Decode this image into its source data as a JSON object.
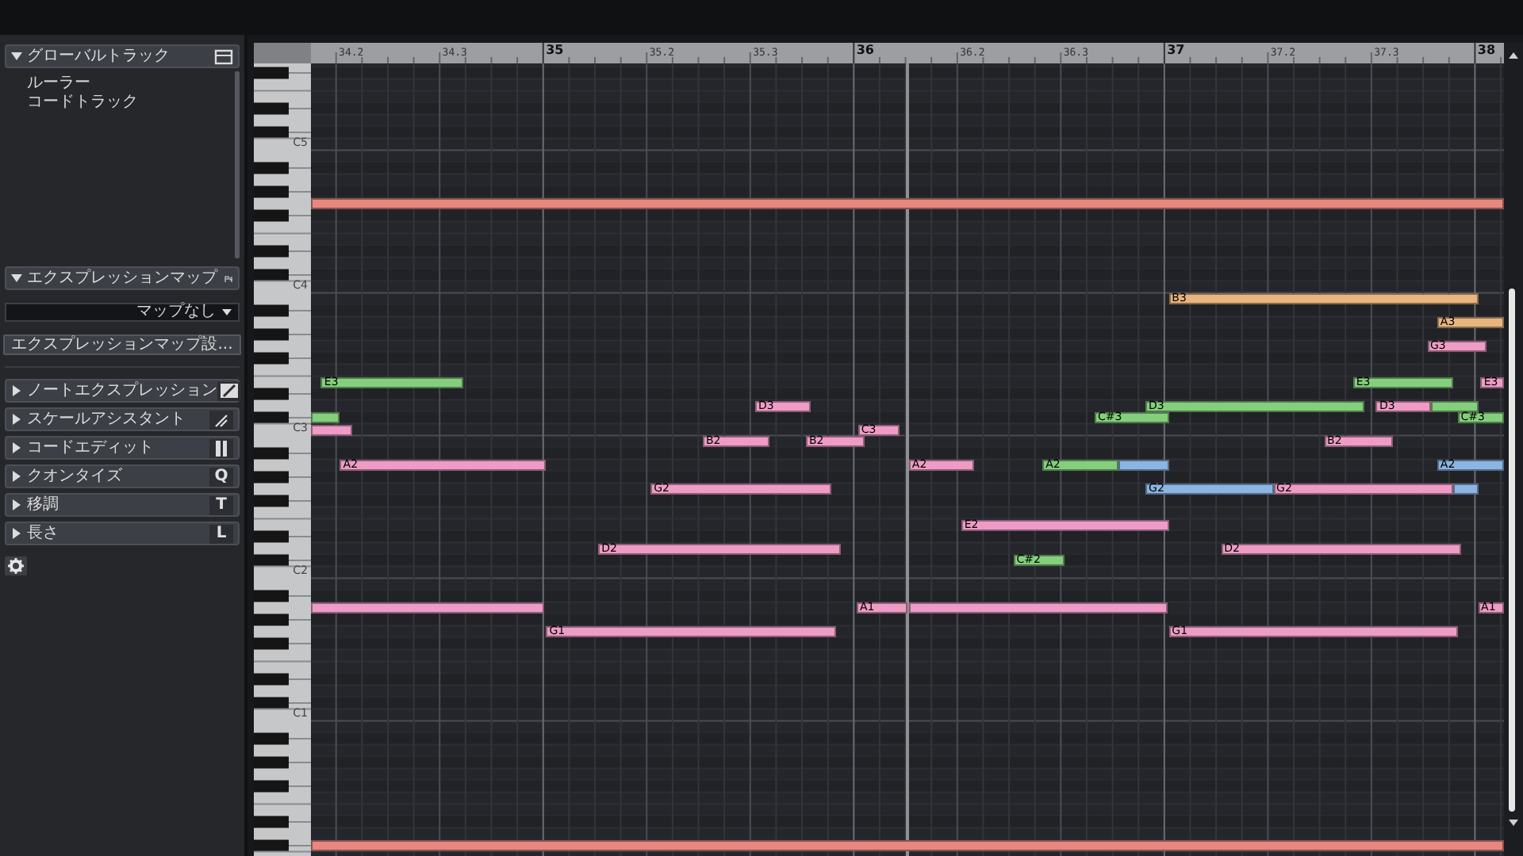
{
  "global_track": {
    "title": "グローバルトラック",
    "expanded": true,
    "items": [
      "ルーラー",
      "コードトラック"
    ]
  },
  "expression_map": {
    "title": "エクスプレッションマップ",
    "expanded": true,
    "dropdown": "マップなし",
    "button": "エクスプレッションマップ設..."
  },
  "sections": [
    {
      "title": "ノートエクスプレッション",
      "expanded": false
    },
    {
      "title": "スケールアシスタント",
      "expanded": false
    },
    {
      "title": "コードエディット",
      "expanded": false
    },
    {
      "title": "クオンタイズ",
      "expanded": false,
      "key": "Q"
    },
    {
      "title": "移調",
      "expanded": false,
      "key": "T"
    },
    {
      "title": "長さ",
      "expanded": false,
      "key": "L"
    }
  ],
  "ruler": [
    {
      "label": "34.2",
      "kind": "beat"
    },
    {
      "label": "34.3",
      "kind": "beat"
    },
    {
      "label": "35",
      "kind": "bar"
    },
    {
      "label": "35.2",
      "kind": "beat"
    },
    {
      "label": "35.3",
      "kind": "beat"
    },
    {
      "label": "36",
      "kind": "bar"
    },
    {
      "label": "36.2",
      "kind": "beat"
    },
    {
      "label": "36.3",
      "kind": "beat"
    },
    {
      "label": "37",
      "kind": "bar"
    },
    {
      "label": "37.2",
      "kind": "beat"
    },
    {
      "label": "37.3",
      "kind": "beat"
    },
    {
      "label": "38",
      "kind": "bar"
    }
  ],
  "keyboard": {
    "octave_labels": [
      "C5",
      "C4",
      "C3",
      "C2",
      "C1"
    ]
  },
  "notes": [
    {
      "color": "#e8877f"
    },
    {
      "label": "B3",
      "color": "#e9b57f"
    },
    {
      "label": "A3",
      "color": "#e9b57f"
    },
    {
      "label": "G3",
      "color": "#ee9cc5"
    },
    {
      "label": "E3",
      "color": "#84cf7c"
    },
    {
      "label": "E3",
      "color": "#84cf7c"
    },
    {
      "label": "E3",
      "color": "#ee9cc5"
    },
    {
      "label": "D3",
      "color": "#ee9cc5"
    },
    {
      "label": "D3",
      "color": "#84cf7c"
    },
    {
      "label": "D3",
      "color": "#ee9cc5"
    },
    {
      "color": "#84cf7c"
    },
    {
      "color": "#84cf7c"
    },
    {
      "label": "C#3",
      "color": "#84cf7c"
    },
    {
      "label": "C#3",
      "color": "#84cf7c"
    },
    {
      "color": "#ee9cc5"
    },
    {
      "label": "C3",
      "color": "#ee9cc5"
    },
    {
      "label": "B2",
      "color": "#ee9cc5"
    },
    {
      "label": "B2",
      "color": "#ee9cc5"
    },
    {
      "label": "B2",
      "color": "#ee9cc5"
    },
    {
      "label": "A2",
      "color": "#ee9cc5"
    },
    {
      "label": "A2",
      "color": "#ee9cc5"
    },
    {
      "label": "A2",
      "color": "#84cf7c"
    },
    {
      "color": "#8bb5e3"
    },
    {
      "label": "A2",
      "color": "#8bb5e3"
    },
    {
      "label": "G2",
      "color": "#ee9cc5"
    },
    {
      "label": "G2",
      "color": "#8bb5e3"
    },
    {
      "label": "G2",
      "color": "#ee9cc5"
    },
    {
      "color": "#8bb5e3"
    },
    {
      "label": "E2",
      "color": "#ee9cc5"
    },
    {
      "label": "D2",
      "color": "#ee9cc5"
    },
    {
      "label": "D2",
      "color": "#ee9cc5"
    },
    {
      "label": "C#2",
      "color": "#84cf7c"
    },
    {
      "color": "#ee9cc5"
    },
    {
      "label": "A1",
      "color": "#ee9cc5"
    },
    {
      "color": "#ee9cc5"
    },
    {
      "label": "A1",
      "color": "#ee9cc5"
    },
    {
      "label": "G1",
      "color": "#ee9cc5"
    },
    {
      "label": "G1",
      "color": "#ee9cc5"
    },
    {
      "color": "#e8877f"
    }
  ]
}
